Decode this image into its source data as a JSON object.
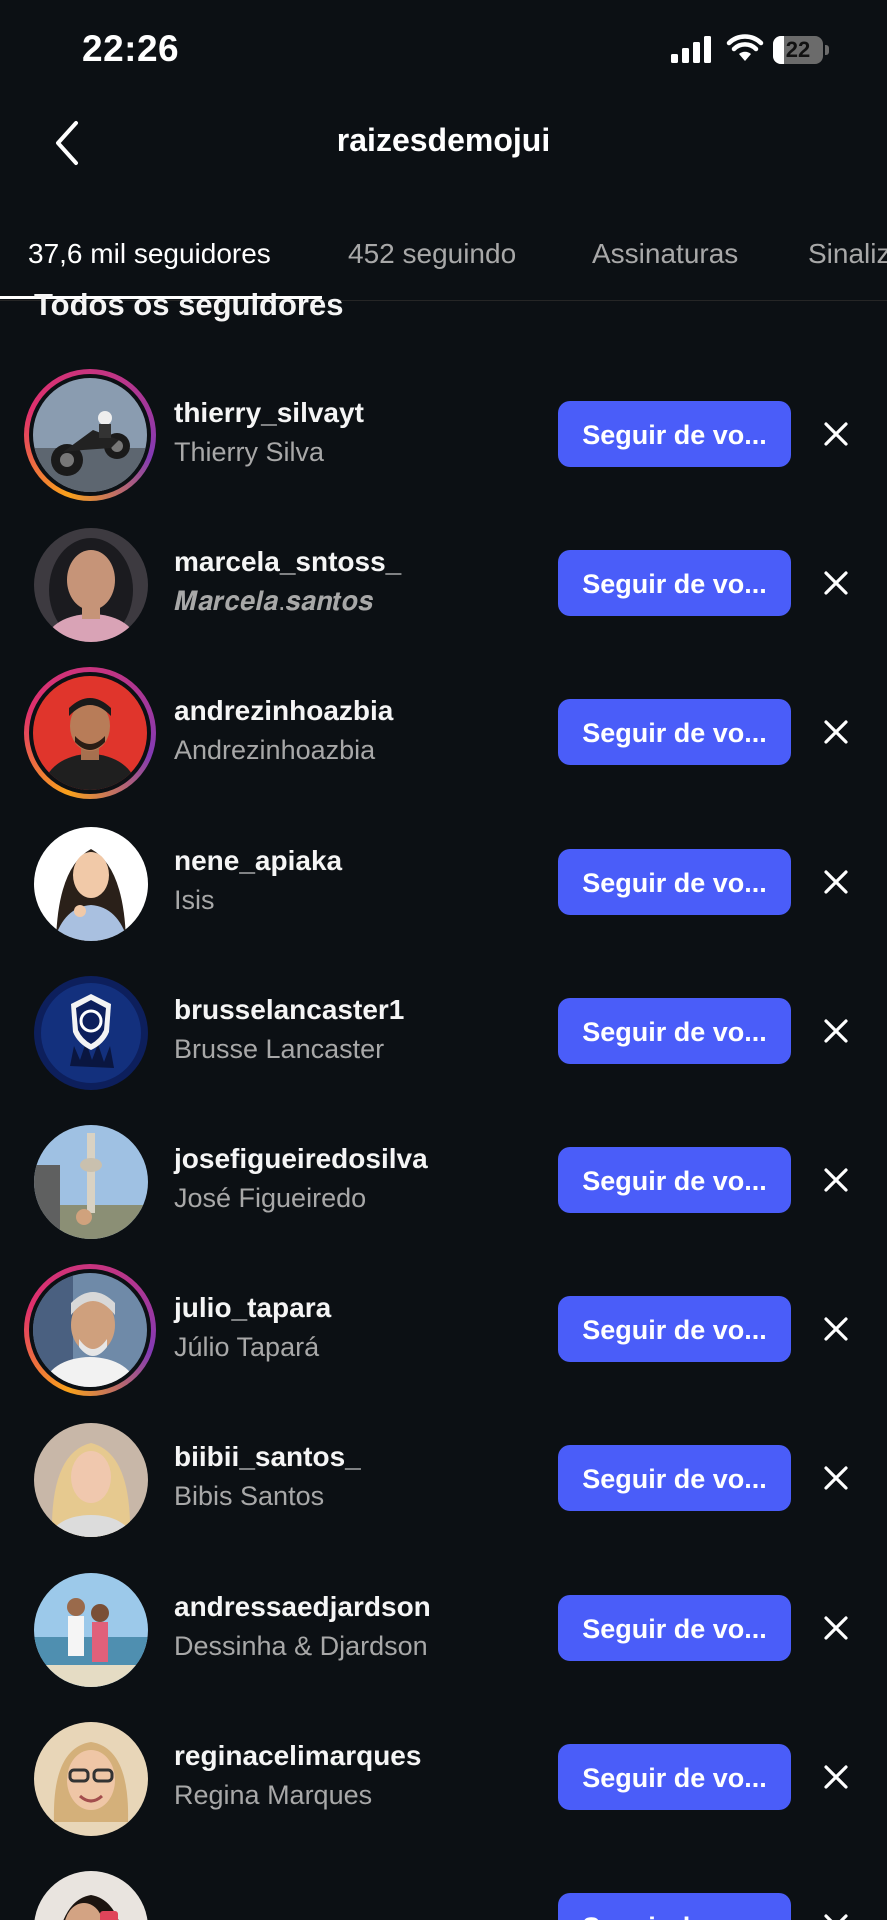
{
  "status_bar": {
    "time": "22:26",
    "battery_level": "22",
    "battery_fraction": 0.22,
    "icons": [
      "signal-icon",
      "wifi-icon",
      "battery-icon"
    ]
  },
  "header": {
    "title": "raizesdemojui",
    "back_icon": "chevron-left-icon"
  },
  "tabs": [
    {
      "label": "37,6 mil seguidores",
      "active": true
    },
    {
      "label": "452 seguindo",
      "active": false
    },
    {
      "label": "Assinaturas",
      "active": false
    },
    {
      "label": "Sinaliz",
      "active": false
    }
  ],
  "section_title": "Todos os seguidores",
  "follow_label": "Seguir de vo...",
  "remove_icon": "close-icon",
  "colors": {
    "background": "#0c1014",
    "accent": "#4a5df9",
    "secondary_text": "#a8a8a8"
  },
  "followers": [
    {
      "username": "thierry_silvayt",
      "name": "Thierry Silva",
      "story_ring": true,
      "avatar": "motorcycle-wheelie-photo",
      "follow": "Seguir de vo..."
    },
    {
      "username": "marcela_sntoss_",
      "name": "𝑴𝒂𝒓𝒄𝒆𝒍𝒂.𝒔𝒂𝒏𝒕𝒐𝒔",
      "story_ring": false,
      "avatar": "woman-selfie-photo",
      "follow": "Seguir de vo..."
    },
    {
      "username": "andrezinhoazbia",
      "name": "Andrezinhoazbia",
      "story_ring": true,
      "avatar": "man-red-background-photo",
      "follow": "Seguir de vo..."
    },
    {
      "username": "nene_apiaka",
      "name": "Isis",
      "story_ring": false,
      "avatar": "illustrated-woman-avatar",
      "follow": "Seguir de vo..."
    },
    {
      "username": "brusselancaster1",
      "name": "Brusse Lancaster",
      "story_ring": false,
      "avatar": "club-crest-logo",
      "follow": "Seguir de vo..."
    },
    {
      "username": "josefigueiredosilva",
      "name": "José Figueiredo",
      "story_ring": false,
      "avatar": "tower-landscape-photo",
      "follow": "Seguir de vo..."
    },
    {
      "username": "julio_tapara",
      "name": "Júlio Tapará",
      "story_ring": true,
      "avatar": "gray-haired-man-photo",
      "follow": "Seguir de vo..."
    },
    {
      "username": "biibii_santos_",
      "name": "Bibis Santos",
      "story_ring": false,
      "avatar": "blonde-woman-photo",
      "follow": "Seguir de vo..."
    },
    {
      "username": "andressaedjardson",
      "name": "Dessinha & Djardson",
      "story_ring": false,
      "avatar": "couple-beach-photo",
      "follow": "Seguir de vo..."
    },
    {
      "username": "reginacelimarques",
      "name": "Regina Marques",
      "story_ring": false,
      "avatar": "woman-glasses-photo",
      "follow": "Seguir de vo..."
    },
    {
      "username": "",
      "name": "",
      "story_ring": false,
      "avatar": "woman-partial-photo",
      "follow": "Seguir de vo..."
    }
  ]
}
